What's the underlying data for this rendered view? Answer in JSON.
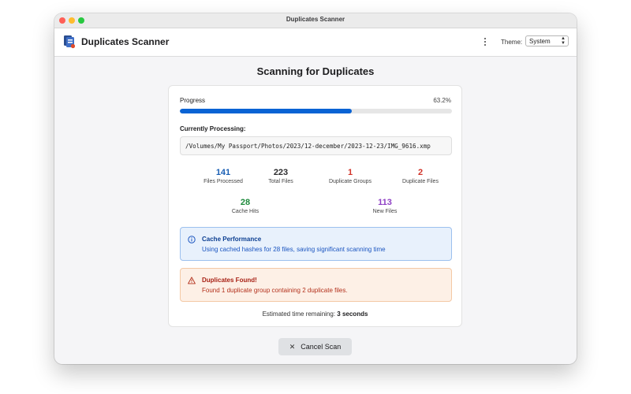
{
  "window": {
    "title": "Duplicates Scanner"
  },
  "header": {
    "app_title": "Duplicates Scanner",
    "more_icon": "vertical-ellipsis-icon",
    "theme_label": "Theme:",
    "theme_value": "System"
  },
  "main": {
    "title": "Scanning for Duplicates",
    "progress": {
      "label": "Progress",
      "percent_text": "63.2%",
      "fraction": 0.632
    },
    "processing": {
      "label": "Currently Processing:",
      "path": "/Volumes/My Passport/Photos/2023/12-december/2023-12-23/IMG_9616.xmp"
    },
    "stats": [
      {
        "value": "141",
        "label": "Files Processed",
        "color": "#1a5fb4"
      },
      {
        "value": "223",
        "label": "Total Files",
        "color": "#2c2c2e"
      },
      {
        "value": "1",
        "label": "Duplicate Groups",
        "color": "#d2342a"
      },
      {
        "value": "2",
        "label": "Duplicate Files",
        "color": "#d2342a"
      },
      {
        "value": "28",
        "label": "Cache Hits",
        "color": "#1e8a3c"
      },
      {
        "value": "113",
        "label": "New Files",
        "color": "#8e3fc4"
      }
    ],
    "cache_alert": {
      "icon": "info-circle-icon",
      "title": "Cache Performance",
      "message": "Using cached hashes for 28 files, saving significant scanning time"
    },
    "duplicates_alert": {
      "icon": "warning-triangle-icon",
      "title": "Duplicates Found!",
      "message": "Found 1 duplicate group containing 2 duplicate files."
    },
    "eta": {
      "prefix": "Estimated time remaining:",
      "value": "3 seconds"
    },
    "cancel_button": {
      "icon": "close-icon",
      "label": "Cancel Scan"
    }
  },
  "colors": {
    "accent": "#0a63d4",
    "info_bg": "#e8f1fc",
    "warning_bg": "#fdf0e6"
  }
}
